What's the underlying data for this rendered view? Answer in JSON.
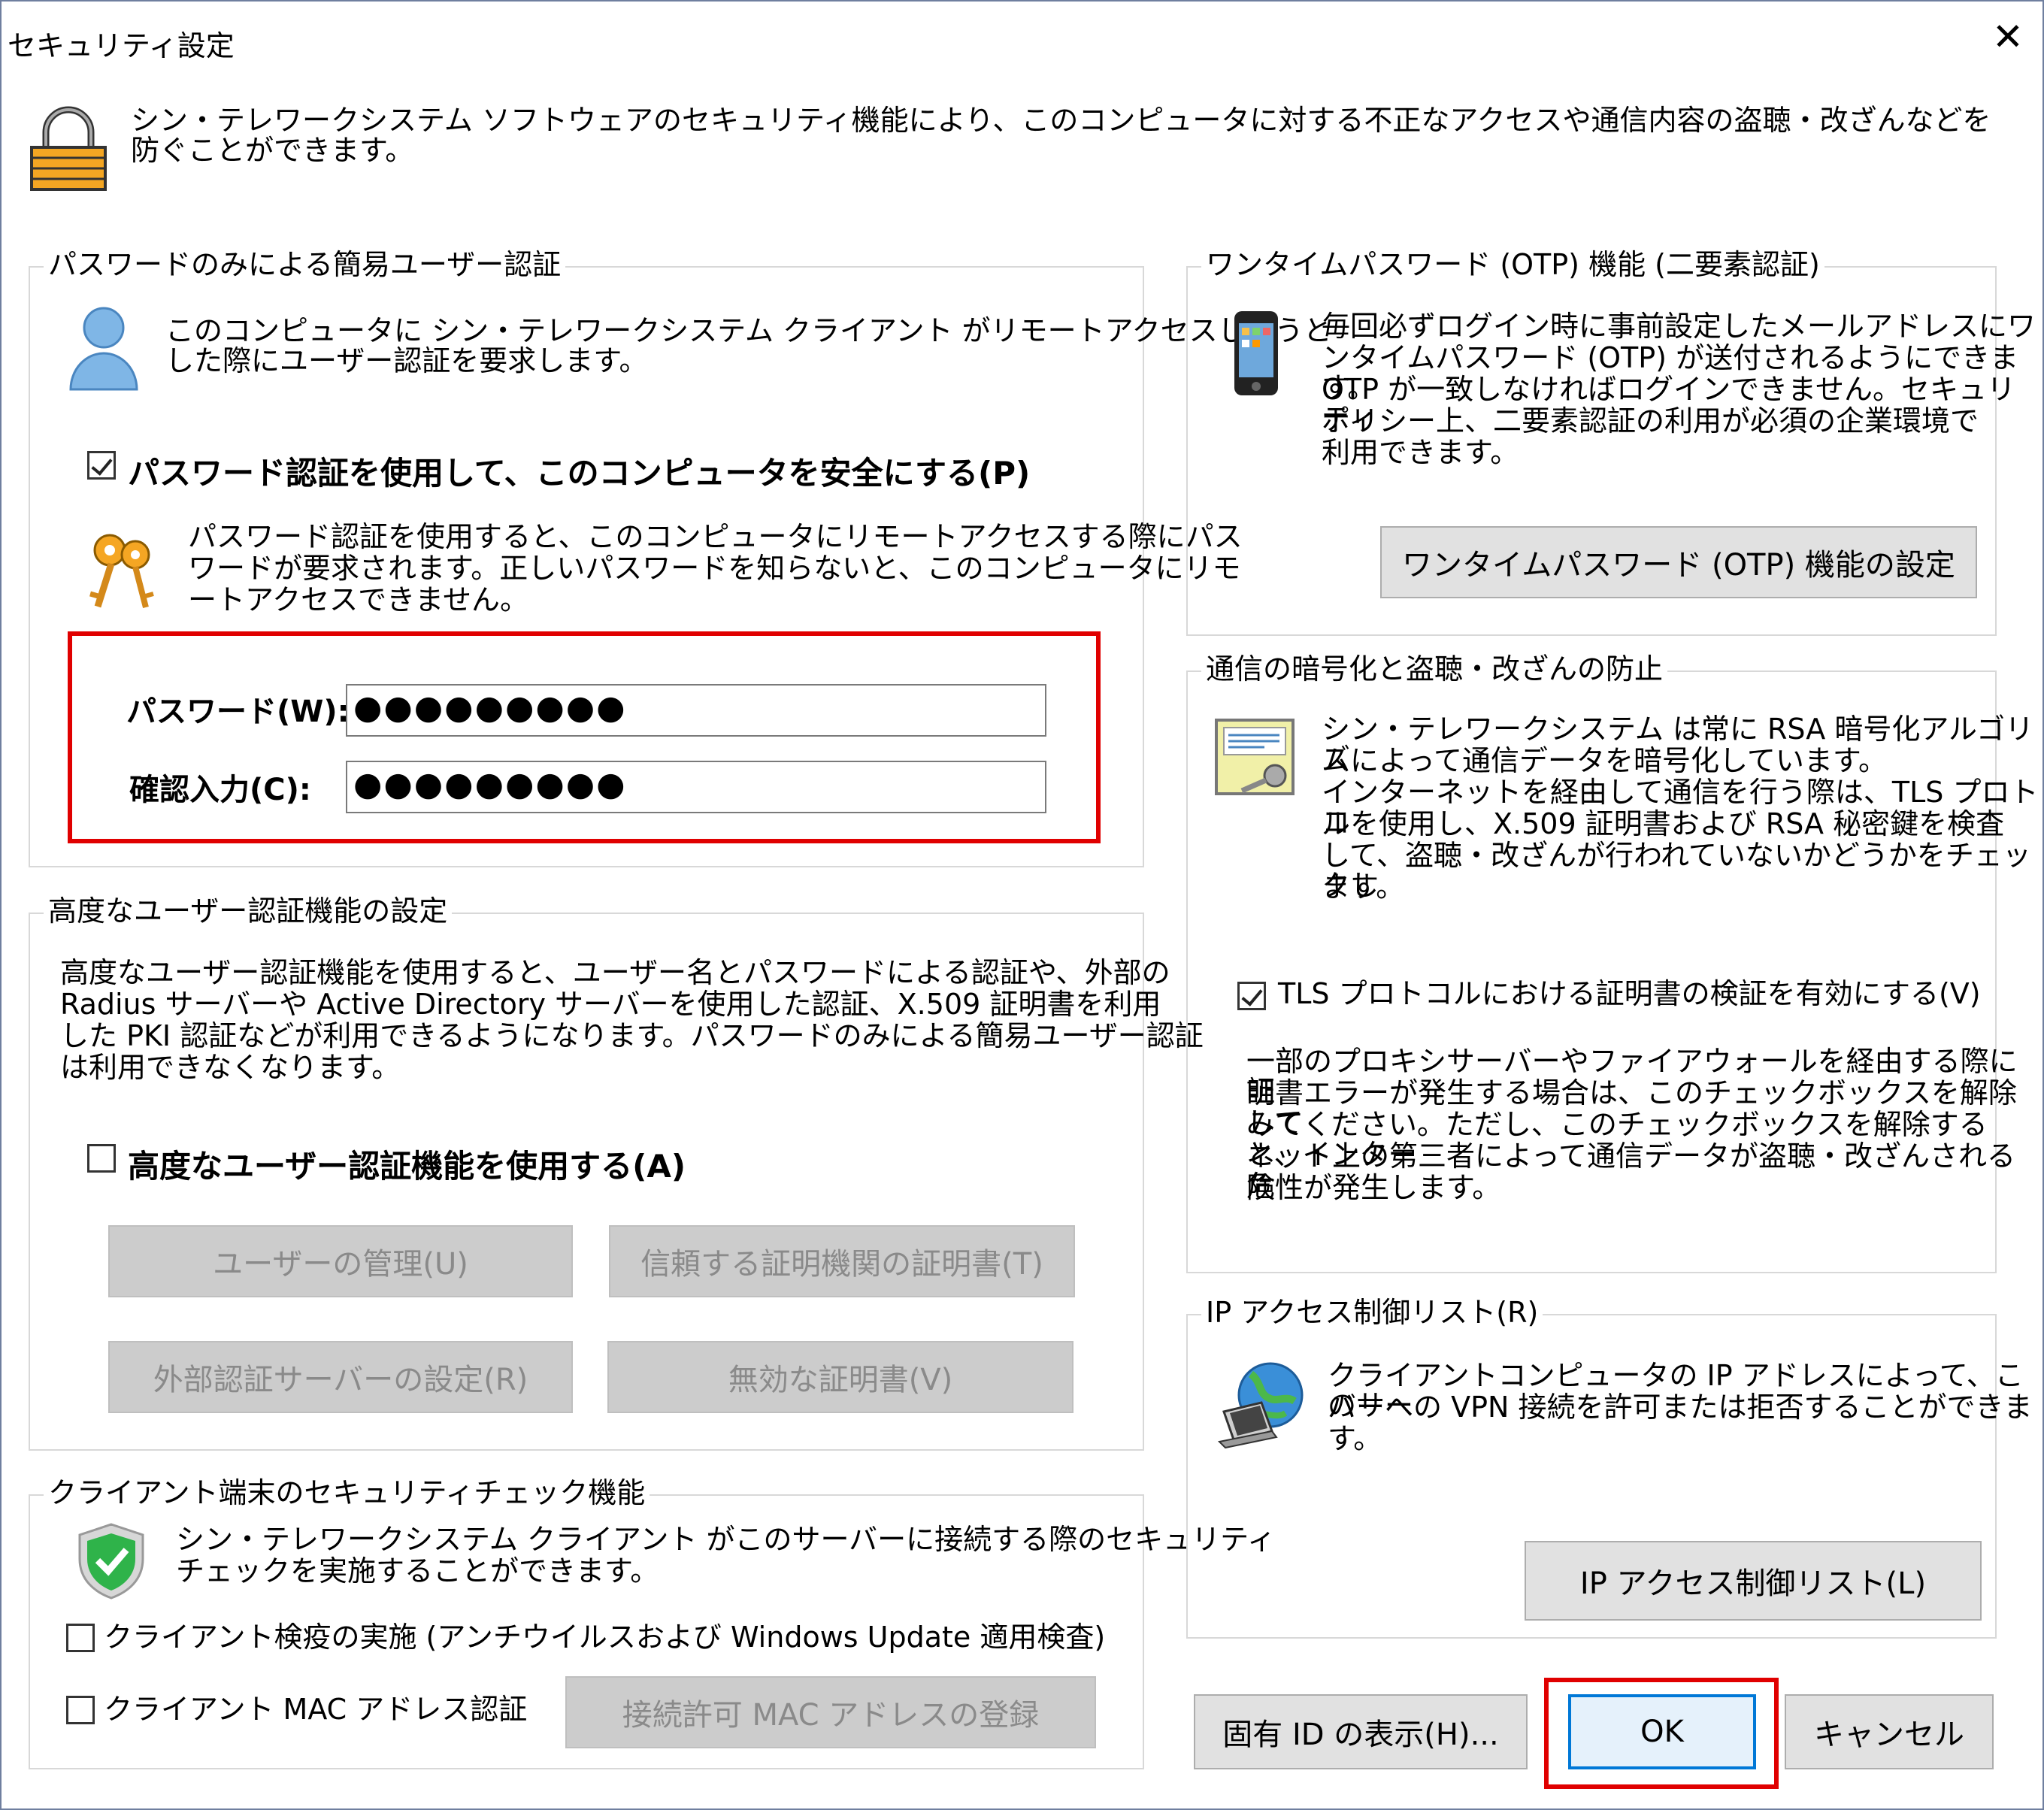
{
  "window": {
    "title": "セキュリティ設定",
    "close_label": "✕",
    "intro": "シン・テレワークシステム ソフトウェアのセキュリティ機能により、このコンピュータに対する不正なアクセスや通信内容の盗聴・改ざんなどを防ぐことができます。"
  },
  "simple_auth": {
    "legend": "パスワードのみによる簡易ユーザー認証",
    "desc_line1": "このコンピュータに シン・テレワークシステム クライアント がリモートアクセスしようと",
    "desc_line2": "した際にユーザー認証を要求します。",
    "checkbox_label": "パスワード認証を使用して、このコンピュータを安全にする(P)",
    "checked": true,
    "keys_line1": "パスワード認証を使用すると、このコンピュータにリモートアクセスする際にパス",
    "keys_line2": "ワードが要求されます。正しいパスワードを知らないと、このコンピュータにリモ",
    "keys_line3": "ートアクセスできません。",
    "password_label": "パスワード(W):",
    "password_value": "●●●●●●●●●",
    "confirm_label": "確認入力(C):",
    "confirm_value": "●●●●●●●●●"
  },
  "advanced_auth": {
    "legend": "高度なユーザー認証機能の設定",
    "desc_line1": "高度なユーザー認証機能を使用すると、ユーザー名とパスワードによる認証や、外部の",
    "desc_line2": "Radius サーバーや Active Directory サーバーを使用した認証、X.509 証明書を利用",
    "desc_line3": "した PKI 認証などが利用できるようになります。パスワードのみによる簡易ユーザー認証",
    "desc_line4": "は利用できなくなります。",
    "checkbox_label": "高度なユーザー認証機能を使用する(A)",
    "checked": false,
    "btn_users": "ユーザーの管理(U)",
    "btn_trusted_ca": "信頼する証明機関の証明書(T)",
    "btn_external_auth": "外部認証サーバーの設定(R)",
    "btn_invalid_cert": "無効な証明書(V)"
  },
  "client_check": {
    "legend": "クライアント端末のセキュリティチェック機能",
    "desc_line1": "シン・テレワークシステム クライアント がこのサーバーに接続する際のセキュリティ",
    "desc_line2": "チェックを実施することができます。",
    "quarantine_label": "クライアント検疫の実施 (アンチウイルスおよび Windows Update 適用検査)",
    "mac_label": "クライアント MAC アドレス認証",
    "btn_mac_register": "接続許可 MAC アドレスの登録"
  },
  "otp": {
    "legend": "ワンタイムパスワード (OTP) 機能 (二要素認証)",
    "desc_line1": "毎回必ずログイン時に事前設定したメールアドレスにワ",
    "desc_line2": "ンタイムパスワード (OTP) が送付されるようにできます。",
    "desc_line3": "OTP が一致しなければログインできません。セキュリティ",
    "desc_line4": "ポリシー上、二要素認証の利用が必須の企業環境で",
    "desc_line5": "利用できます。",
    "btn_otp": "ワンタイムパスワード (OTP) 機能の設定"
  },
  "encryption": {
    "legend": "通信の暗号化と盗聴・改ざんの防止",
    "desc_line1": "シン・テレワークシステム は常に RSA 暗号化アルゴリズ",
    "desc_line2": "ムによって通信データを暗号化しています。",
    "desc_line3": "インターネットを経由して通信を行う際は、TLS プロトコ",
    "desc_line4": "ルを使用し、X.509 証明書および RSA 秘密鍵を検査",
    "desc_line5": "して、盗聴・改ざんが行われていないかどうかをチェックし",
    "desc_line6": "ます。",
    "checkbox_label": "TLS プロトコルにおける証明書の検証を有効にする(V)",
    "checked": true,
    "note_line1": "一部のプロキシサーバーやファイアウォールを経由する際に証",
    "note_line2": "明書エラーが発生する場合は、このチェックボックスを解除して",
    "note_line3": "みてください。ただし、このチェックボックスを解除すると、インター",
    "note_line4": "ネット上の第三者によって通信データが盗聴・改ざんされる危",
    "note_line5": "険性が発生します。"
  },
  "ip_acl": {
    "legend": "IP アクセス制御リスト(R)",
    "desc_line1": "クライアントコンピュータの IP アドレスによって、このサー",
    "desc_line2": "バーへの VPN 接続を許可または拒否することができま",
    "desc_line3": "す。",
    "btn_ip_acl": "IP アクセス制御リスト(L)"
  },
  "footer": {
    "btn_show_id": "固有 ID の表示(H)...",
    "btn_ok": "OK",
    "btn_cancel": "キャンセル"
  },
  "colors": {
    "highlight": "#e00000",
    "accent": "#0078d7"
  }
}
